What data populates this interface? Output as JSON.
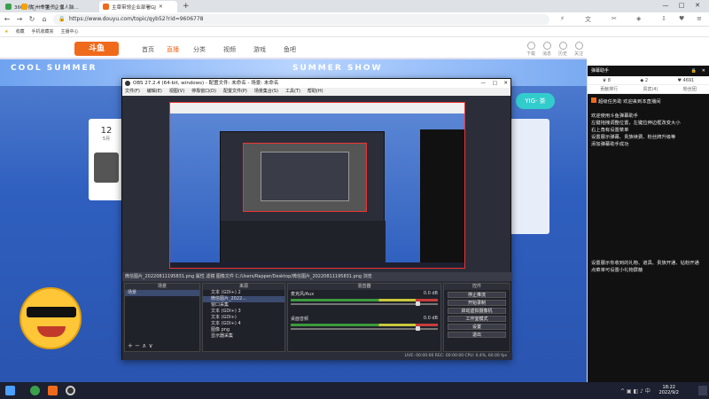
{
  "browser": {
    "tabs": [
      {
        "title": "360导航_一个主页，整个世界",
        "active": false
      },
      {
        "title": "兰州市第一企业人脑…",
        "active": false
      },
      {
        "title": "主章带领企业部署GJ",
        "active": true
      }
    ],
    "new_tab": "+",
    "window_buttons": [
      "—",
      "□",
      "✕"
    ],
    "url": "https://www.douyu.com/topic/qyb52?rid=9606778",
    "bookmarks": [
      "收藏",
      "手机收藏夹",
      "主播中心"
    ]
  },
  "site": {
    "logo": "斗鱼",
    "nav": [
      "首页",
      "直播",
      "分类",
      "视频",
      "游戏",
      "鱼吧"
    ],
    "nav_active": 1,
    "top_icons": [
      "下载",
      "消息",
      "历史",
      "关注",
      "开播"
    ],
    "banner_left": "COOL SUMMER",
    "banner_mid": "SUMMER SHOW",
    "left_card_date": "12",
    "left_card_month": "5月",
    "right_badge": "YIG· 茶"
  },
  "obs": {
    "title": "OBS 27.2.4 (64-bit, windows) - 配置文件: 未命名 - 场景: 未命名",
    "win_buttons": [
      "—",
      "□",
      "✕"
    ],
    "menu": [
      "文件(F)",
      "编辑(E)",
      "视图(V)",
      "停靠窗口(D)",
      "配置文件(P)",
      "场景集合(S)",
      "工具(T)",
      "帮助(H)"
    ],
    "preview_bar": "微信图片_20220811195831.png    属性    滤镜    图像文件    C:/Users/Rapper/Desktop/微信图片_20220811195831.png    浏览",
    "panels": {
      "scenes": {
        "title": "场景",
        "items": [
          "场景"
        ]
      },
      "sources": {
        "title": "来源",
        "items": [
          "文本 (GDI+) 2",
          "微信图片_2022...",
          "窗口采集",
          "文本 (GDI+) 3",
          "文本 (GDI+)",
          "文本 (GDI+) 4",
          "图像 png",
          "显示器采集"
        ]
      },
      "mixer": {
        "title": "混音器",
        "channels": [
          {
            "name": "麦克风/Aux",
            "db": "0.0 dB"
          },
          {
            "name": "桌面音频",
            "db": "0.0 dB"
          }
        ]
      },
      "controls": {
        "title": "控件",
        "buttons": [
          "停止推流",
          "开始录制",
          "启动虚拟摄像机",
          "工作室模式",
          "设置",
          "退出"
        ]
      }
    },
    "status": "LIVE: 00:00:00   REC: 00:00:00   CPU: 0.4%, 60.00 fps"
  },
  "chat": {
    "header": "弹幕助手",
    "stats": [
      "8",
      "2",
      "4691"
    ],
    "tabs": [
      "贡献排行",
      "贵宾(4)",
      "粉丝团"
    ],
    "messages": [
      "超级任务助 欢迎来到本直播间",
      "欢迎使用斗鱼弹幕助手",
      "左键拖拽调整位置，左键拉伸边框改变大小",
      "右上角有设置菜单",
      "设置展示弹幕、贵族续费、粉丝牌升级等",
      "添加弹幕助手成功",
      "设置展示你收到的礼物、道具、贵族开通、钻粉开通",
      "点菜单可设置小礼物屏蔽"
    ]
  },
  "taskbar": {
    "time": "18:22",
    "date": "2022/9/2"
  }
}
